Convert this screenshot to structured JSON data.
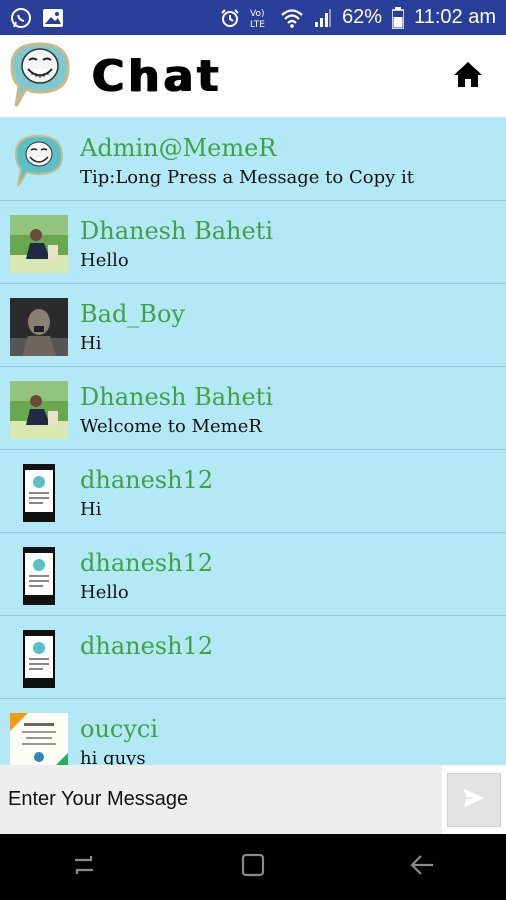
{
  "status_bar": {
    "left_icons": [
      "whatsapp-icon",
      "image-icon"
    ],
    "right_icons": [
      "alarm-icon",
      "volte-icon",
      "wifi-icon",
      "signal-icon",
      "battery-icon"
    ],
    "battery": "62%",
    "time": "11:02 am"
  },
  "header": {
    "title": "Chat",
    "home_icon": "home-icon"
  },
  "messages": [
    {
      "name": "Admin@MemeR",
      "text": "Tip:Long Press a Message to Copy it",
      "avatar": "troll-logo"
    },
    {
      "name": "Dhanesh Baheti",
      "text": "Hello",
      "avatar": "photo-green"
    },
    {
      "name": "Bad_Boy",
      "text": "Hi",
      "avatar": "photo-dark"
    },
    {
      "name": "Dhanesh Baheti",
      "text": "Welcome to MemeR",
      "avatar": "photo-green"
    },
    {
      "name": "dhanesh12",
      "text": "Hi",
      "avatar": "screenshot-thumb"
    },
    {
      "name": "dhanesh12",
      "text": "Hello",
      "avatar": "screenshot-thumb"
    },
    {
      "name": "dhanesh12",
      "text": "",
      "avatar": "screenshot-thumb"
    },
    {
      "name": "oucyci",
      "text": "hi guys",
      "avatar": "card-thumb"
    }
  ],
  "input": {
    "placeholder": "Enter Your Message",
    "send_icon": "send-icon"
  },
  "nav": {
    "icons": [
      "recent-apps-icon",
      "home-nav-icon",
      "back-icon"
    ]
  },
  "colors": {
    "status_bar": "#2a3f9a",
    "list_background": "#b3e9f7",
    "name_text": "#43a047",
    "divider": "#8fc9db"
  }
}
